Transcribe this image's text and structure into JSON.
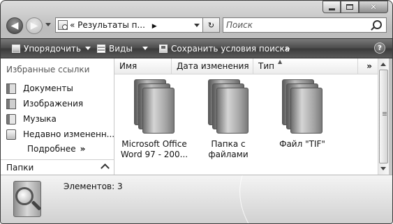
{
  "window": {
    "min_icon": "minimize-icon",
    "max_icon": "maximize-icon",
    "close_glyph": "✕"
  },
  "nav": {
    "back_glyph": "◀",
    "forward_glyph": "▶"
  },
  "address": {
    "prefix": "«",
    "crumb": "Результаты п...",
    "crumb_arrow": "▶",
    "refresh_glyph": "↻"
  },
  "search": {
    "placeholder": "Поиск"
  },
  "toolbar": {
    "organize": "Упорядочить",
    "views": "Виды",
    "save": "Сохранить условия поиска",
    "more": "»",
    "help": "?"
  },
  "sidebar": {
    "favorites_title": "Избранные ссылки",
    "items": [
      {
        "label": "Документы",
        "icon": "documents-icon"
      },
      {
        "label": "Изображения",
        "icon": "pictures-icon"
      },
      {
        "label": "Музыка",
        "icon": "music-icon"
      },
      {
        "label": "Недавно измененн...",
        "icon": "recent-icon"
      }
    ],
    "more_label": "Подробнее",
    "more_glyph": "»",
    "folders_label": "Папки"
  },
  "columns": {
    "name": "Имя",
    "date": "Дата изменения",
    "type": "Тип",
    "more": "»"
  },
  "files": [
    {
      "line1": "Microsoft Office",
      "line2": "Word 97 - 200..."
    },
    {
      "line1": "Папка с файлами",
      "line2": ""
    },
    {
      "line1": "Файл \"TIF\"",
      "line2": ""
    }
  ],
  "details": {
    "count_text": "Элементов: 3"
  }
}
